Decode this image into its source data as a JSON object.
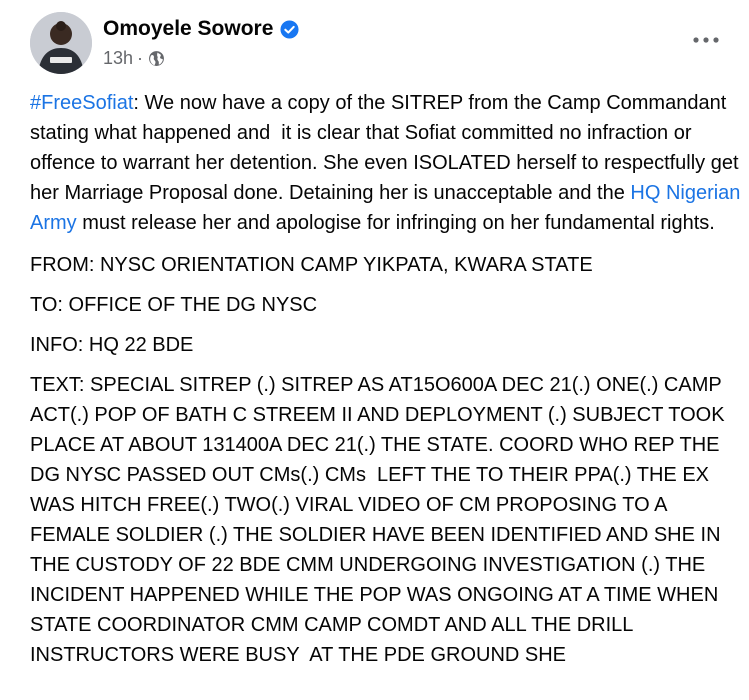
{
  "post": {
    "author": "Omoyele Sowore",
    "time": "13h",
    "separator": "·",
    "icons": {
      "verified": "verified-badge-icon",
      "audience": "globe-icon",
      "more": "more-options-icon",
      "verified_color": "#1877f2"
    },
    "paragraph1": {
      "hashtag": "#FreeSofiat",
      "text_before_link": ": We now have a copy of the SITREP from the Camp Commandant stating what happened and  it is clear that Sofiat committed no infraction or offence to warrant her detention. She even ISOLATED herself to respectfully get her Marriage Proposal done. Detaining her is unacceptable and the ",
      "link": "HQ Nigerian Army",
      "text_after_link": " must release her and apologise for infringing on her fundamental rights."
    },
    "from_line": "FROM: NYSC ORIENTATION CAMP YIKPATA, KWARA STATE",
    "to_line": "TO: OFFICE OF THE DG NYSC",
    "info_line": "INFO: HQ 22 BDE",
    "text_block": "TEXT: SPECIAL SITREP (.) SITREP AS AT15O600A DEC 21(.) ONE(.) CAMP ACT(.) POP OF BATH C STREEM II AND DEPLOYMENT (.) SUBJECT TOOK PLACE AT ABOUT 131400A DEC 21(.) THE STATE. COORD WHO REP THE DG NYSC PASSED OUT CMs(.) CMs  LEFT THE TO THEIR PPA(.) THE EX WAS HITCH FREE(.) TWO(.) VIRAL VIDEO OF CM PROPOSING TO A FEMALE SOLDIER (.) THE SOLDIER HAVE BEEN IDENTIFIED AND SHE IN THE CUSTODY OF 22 BDE CMM UNDERGOING INVESTIGATION (.) THE INCIDENT HAPPENED WHILE THE POP WAS ONGOING AT A TIME WHEN STATE COORDINATOR CMM CAMP COMDT AND ALL THE DRILL INSTRUCTORS WERE BUSY  AT THE PDE GROUND SHE"
  }
}
